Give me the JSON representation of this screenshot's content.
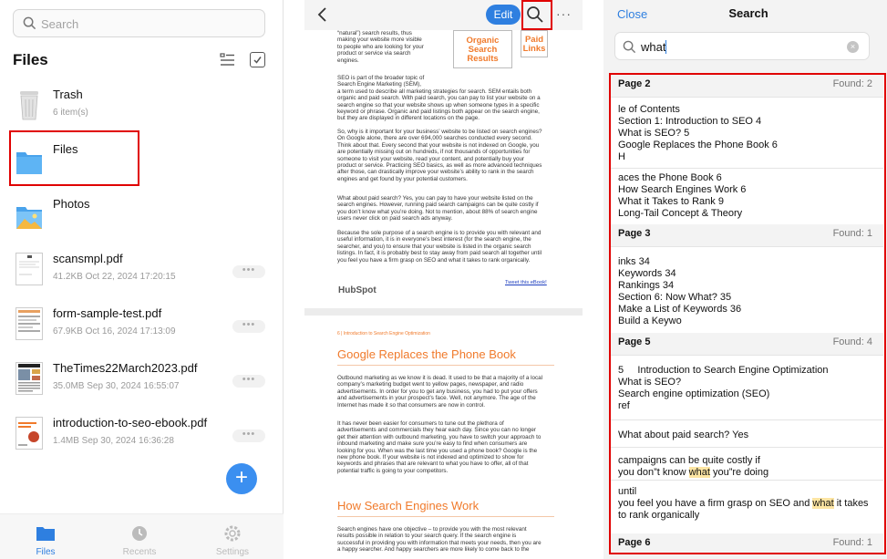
{
  "files_panel": {
    "search_placeholder": "Search",
    "title": "Files",
    "items": [
      {
        "name": "Trash",
        "sub": "6 item(s)",
        "icon": "trash-can-icon"
      },
      {
        "name": "Files",
        "sub": "",
        "icon": "folder-icon"
      },
      {
        "name": "Photos",
        "sub": "",
        "icon": "photos-folder-icon"
      },
      {
        "name": "scansmpl.pdf",
        "sub": "41.2KB Oct 22, 2024 17:20:15",
        "icon": "pdf-thumbnail"
      },
      {
        "name": "form-sample-test.pdf",
        "sub": "67.9KB Oct 16, 2024 17:13:09",
        "icon": "pdf-thumbnail"
      },
      {
        "name": "TheTimes22March2023.pdf",
        "sub": "35.0MB Sep 30, 2024 16:55:07",
        "icon": "pdf-thumbnail"
      },
      {
        "name": "introduction-to-seo-ebook.pdf",
        "sub": "1.4MB Sep 30, 2024 16:36:28",
        "icon": "pdf-thumbnail"
      }
    ],
    "more_label": "•••",
    "fab_label": "+",
    "tabs": [
      {
        "label": "Files",
        "icon": "folder-icon"
      },
      {
        "label": "Recents",
        "icon": "clock-icon"
      },
      {
        "label": "Settings",
        "icon": "gear-icon"
      }
    ],
    "accent": "#2e7fe0"
  },
  "document_panel": {
    "edit_label": "Edit",
    "more_label": "···",
    "page1": {
      "lead": "“natural”) search results, thus\nmaking your website more visible\nto people who are looking for your\nproduct or service via search\nengines.",
      "organic": "Organic\nSearch\nResults",
      "paid": "Paid\nLinks",
      "p1": "SEO is part of the broader topic of\nSearch Engine Marketing (SEM),\na term used to describe all marketing strategies for search. SEM entails both\norganic and paid search. With paid search, you can pay to list your website on a\nsearch engine so that your website shows up when someone types in a specific\nkeyword or phrase. Organic and paid listings both appear on the search engine,\nbut they are displayed in different locations on the page.",
      "p2": "So, why is it important for your business’ website to be listed on search engines?\nOn Google alone, there are over 694,000 searches conducted every second.\nThink about that. Every second that your website is not indexed on Google, you\nare potentially missing out on hundreds, if not thousands of opportunities for\nsomeone to visit your website, read your content, and potentially buy your\nproduct or service. Practicing SEO basics, as well as more advanced techniques\nafter those, can drastically improve your website’s ability to rank in the search\nengines and get found by your potential customers.",
      "p3": "What about paid search? Yes, you can pay to have your website listed on the\nsearch engines. However, running paid search campaigns can be quite costly if\nyou don’t know what you’re doing. Not to mention, about 88% of search engine\nusers never click on paid search ads anyway.",
      "p4": "Because the sole purpose of a search engine is to provide you with relevant and\nuseful information, it is in everyone’s best interest (for the search engine, the\nsearcher, and you) to ensure that your website is listed in the organic search\nlistings. In fact, it is probably best to stay away from paid search all together until\nyou feel you have a firm grasp on SEO and what it takes to rank organically.",
      "logo": "HubSpot",
      "tweet": "Tweet this eBook!"
    },
    "page2": {
      "crumb": "6  |  Introduction to Search Engine Optimization",
      "heading1": "Google Replaces the Phone Book",
      "p1": "Outbound marketing as we know it is dead. It used to be that a majority of a local\ncompany’s marketing budget went to yellow pages, newspaper, and radio\nadvertisements. In order for you to get any business, you had to put your offers\nand advertisements in your prospect’s face. Well, not anymore. The age of the\nInternet has made it so that consumers are now in control.",
      "p2": "It has never been easier for consumers to tune out the plethora of\nadvertisements and commercials they hear each day. Since you can no longer\nget their attention with outbound marketing, you have to switch your approach to\ninbound marketing and make sure you’re easy to find when consumers are\nlooking for you. When was the last time you used a phone book? Google is the\nnew phone book. If your website is not indexed and optimized to show for\nkeywords and phrases that are relevant to what you have to offer, all of that\npotential traffic is going to your competitors.",
      "heading2": "How Search Engines Work",
      "p3": "Search engines have one objective – to provide you with the most relevant\nresults possible in relation to your search query. If the search engine is\nsuccessful in providing you with information that meets your needs, then you are\na happy searcher. And happy searchers are more likely to come back to the"
    }
  },
  "search_panel": {
    "close_label": "Close",
    "title": "Search",
    "query": "what",
    "clear_label": "×",
    "groups": [
      {
        "page": "Page 2",
        "found": "Found: 2",
        "snippets": [
          "le of Contents\nSection 1: Introduction to SEO 4\nWhat is SEO? 5\nGoogle Replaces the Phone Book 6\nH",
          "aces the Phone Book 6\nHow Search Engines Work 6\nWhat it Takes to Rank 9\nLong-Tail Concept & Theory"
        ]
      },
      {
        "page": "Page 3",
        "found": "Found: 1",
        "snippets": [
          "inks 34\nKeywords 34\nRankings 34\nSection 6: Now What? 35\nMake a List of Keywords 36\nBuild a Keywo"
        ]
      },
      {
        "page": "Page 5",
        "found": "Found: 4",
        "snippets": [
          "5     Introduction to Search Engine Optimization\nWhat is SEO?\nSearch engine optimization (SEO)\nref",
          "What about paid search? Yes",
          {
            "pre": "campaigns can be quite costly if\nyou don”t know ",
            "hit": "what",
            "post": " you”re doing"
          },
          {
            "pre": "until\nyou feel you have a firm grasp on SEO and ",
            "hit": "what",
            "post": " it takes\nto rank organically"
          }
        ]
      },
      {
        "page": "Page 6",
        "found": "Found: 1",
        "snippets": []
      }
    ],
    "highlight_color": "#fde5a3"
  },
  "annotation_color": "#e00000"
}
